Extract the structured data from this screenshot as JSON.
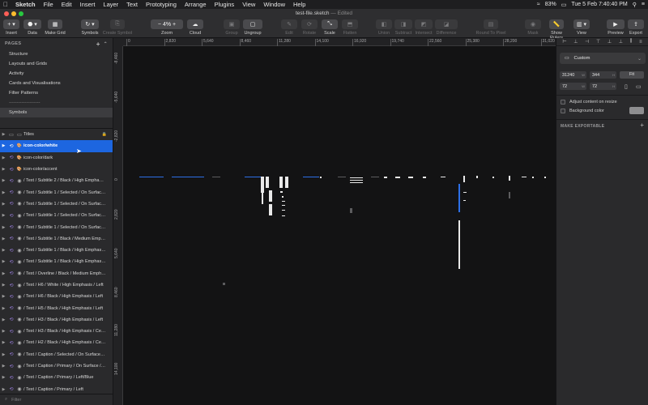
{
  "menubar": {
    "apple": "",
    "items": [
      "Sketch",
      "File",
      "Edit",
      "Insert",
      "Layer",
      "Text",
      "Prototyping",
      "Arrange",
      "Plugins",
      "View",
      "Window",
      "Help"
    ],
    "status": {
      "battery": "83%",
      "datetime": "Tue 5 Feb  7:40:40 PM"
    }
  },
  "window": {
    "title": "test-file.sketch",
    "edited": " — Edited"
  },
  "toolbar": {
    "insert": "Insert",
    "data": "Data",
    "make_grid": "Make Grid",
    "symbols": "Symbols",
    "create_symbol": "Create Symbol",
    "zoom_label": "Zoom",
    "zoom_value": "4%",
    "cloud": "Cloud",
    "group": "Group",
    "ungroup": "Ungroup",
    "edit": "Edit",
    "rotate": "Rotate",
    "scale": "Scale",
    "flatten": "Flatten",
    "union": "Union",
    "subtract": "Subtract",
    "intersect": "Intersect",
    "difference": "Difference",
    "round_to_pixel": "Round To Pixel",
    "mask": "Mask",
    "show_rulers": "Show Rulers",
    "view": "View",
    "preview": "Preview",
    "export": "Export"
  },
  "pages": {
    "header": "PAGES",
    "items": [
      "Structure",
      "Layouts and Grids",
      "Activity",
      "Cards and Visualisations",
      "Filter Patterns",
      "--------------------",
      "Symbols"
    ],
    "selected": "Symbols"
  },
  "layers": [
    {
      "label": "Titles",
      "kind": "folder"
    },
    {
      "label": "icon-color/white",
      "kind": "symbol",
      "selected": true
    },
    {
      "label": "icon-color/dark",
      "kind": "symbol"
    },
    {
      "label": "icon-color/accent",
      "kind": "symbol"
    },
    {
      "label": "/ Text / Subtitle 2 / Black / High Empha…",
      "kind": "text"
    },
    {
      "label": "/ Text / Subtitle 1 / Selected / On Surfac…",
      "kind": "text"
    },
    {
      "label": "/ Text / Subtitle 1 / Selected / On Surfac…",
      "kind": "text"
    },
    {
      "label": "/ Text / Subtitle 1 / Selected / On Surfac…",
      "kind": "text"
    },
    {
      "label": "/ Text / Subtitle 1 / Selected / On Surfac…",
      "kind": "text"
    },
    {
      "label": "/ Text / Subtitle 1 / Black / Medium Emp…",
      "kind": "text"
    },
    {
      "label": "/ Text / Subtitle 1 / Black / High Emphas…",
      "kind": "text"
    },
    {
      "label": "/ Text / Subtitle 1 / Black / High Emphas…",
      "kind": "text"
    },
    {
      "label": "/ Text / Overline / Black / Medium Emph…",
      "kind": "text"
    },
    {
      "label": "/ Text / H6 / White / High Emphasis / Left",
      "kind": "text"
    },
    {
      "label": "/ Text / H6 / Black / High Emphasis / Left",
      "kind": "text"
    },
    {
      "label": "/ Text / H5 / Black / High Emphasis / Left",
      "kind": "text"
    },
    {
      "label": "/ Text / H3 / Black / High Emphasis / Left",
      "kind": "text"
    },
    {
      "label": "/ Text / H3 / Black / High Emphasis / Ce…",
      "kind": "text"
    },
    {
      "label": "/ Text / H2 / Black / High Emphasis / Ce…",
      "kind": "text"
    },
    {
      "label": "/ Text / Caption / Selected / On Surface…",
      "kind": "text"
    },
    {
      "label": "/ Text / Caption / Primary / On Surface /…",
      "kind": "text"
    },
    {
      "label": "/ Text / Caption / Primary / Left/Blue",
      "kind": "text"
    },
    {
      "label": "/ Text / Caption / Primary / Left",
      "kind": "text"
    }
  ],
  "filter": {
    "label": "Filter"
  },
  "rulers": {
    "top": [
      "0",
      "2,820",
      "5,640",
      "8,460",
      "11,280",
      "14,100",
      "16,920",
      "19,740",
      "22,560",
      "25,380",
      "28,200",
      "31,020"
    ],
    "left": [
      "-8,460",
      "-5,640",
      "-2,820",
      "0",
      "2,820",
      "5,640",
      "8,460",
      "11,280",
      "14,100"
    ]
  },
  "inspector": {
    "preset": "Custom",
    "width": "31240",
    "width_unit": "W",
    "height": "344",
    "height_unit": "H",
    "fit": "Fit",
    "x": "72",
    "x_unit": "W",
    "y": "72",
    "y_unit": "H",
    "adjust_content": "Adjust content on resize",
    "background_color": "Background color",
    "make_exportable": "MAKE EXPORTABLE"
  },
  "colors": {
    "accent": "#1d66e0",
    "canvas": "#131314",
    "panel": "#2a2a2c"
  }
}
